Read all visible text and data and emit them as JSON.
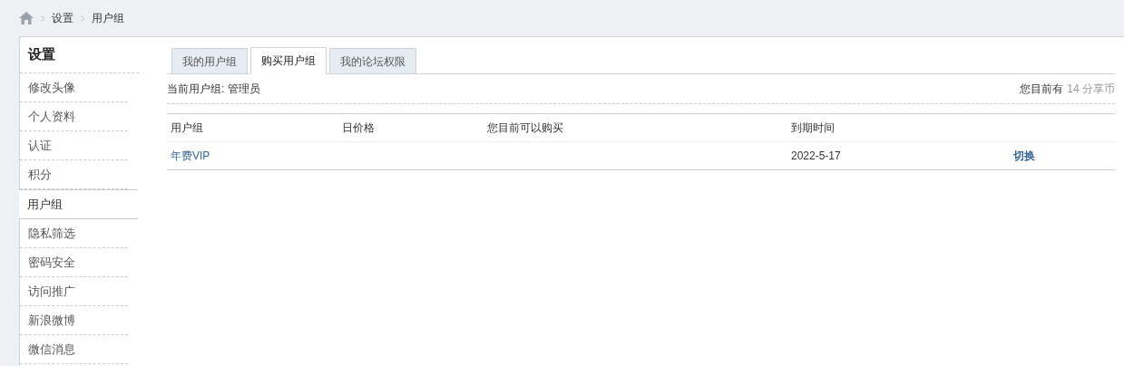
{
  "breadcrumb": [
    "设置",
    "用户组"
  ],
  "sidebar": {
    "title": "设置",
    "items": [
      {
        "label": "修改头像",
        "selected": false
      },
      {
        "label": "个人资料",
        "selected": false
      },
      {
        "label": "认证",
        "selected": false
      },
      {
        "label": "积分",
        "selected": false
      },
      {
        "label": "用户组",
        "selected": true
      },
      {
        "label": "隐私筛选",
        "selected": false
      },
      {
        "label": "密码安全",
        "selected": false
      },
      {
        "label": "访问推广",
        "selected": false
      },
      {
        "label": "新浪微博",
        "selected": false
      },
      {
        "label": "微信消息",
        "selected": false
      }
    ]
  },
  "tabs": [
    {
      "label": "我的用户组",
      "selected": false
    },
    {
      "label": "购买用户组",
      "selected": true
    },
    {
      "label": "我的论坛权限",
      "selected": false
    }
  ],
  "current_group": "当前用户组: 管理员",
  "balance": {
    "label": "您目前有",
    "value": "14 分享币"
  },
  "table": {
    "columns": [
      "用户组",
      "日价格",
      "您目前可以购买",
      "到期时间"
    ],
    "rows": [
      {
        "group": "年费VIP",
        "expiry": "2022-5-17",
        "action": "切换"
      }
    ]
  }
}
